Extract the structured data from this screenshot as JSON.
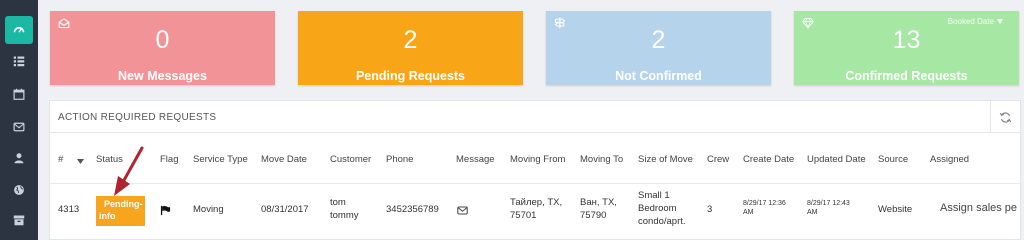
{
  "sidebar": {
    "items": [
      {
        "icon": "dashboard-icon",
        "active": true
      },
      {
        "icon": "list-icon"
      },
      {
        "icon": "calendar-icon"
      },
      {
        "icon": "envelope-icon"
      },
      {
        "icon": "user-icon"
      },
      {
        "icon": "globe-icon"
      },
      {
        "icon": "archive-icon"
      }
    ]
  },
  "cards": [
    {
      "count": "0",
      "label": "New Messages",
      "color": "#f29497",
      "icon": "envelope-open-icon"
    },
    {
      "count": "2",
      "label": "Pending Requests",
      "color": "#f9a518"
    },
    {
      "count": "2",
      "label": "Not Confirmed",
      "color": "#b5d3ea",
      "icon": "signpost-icon"
    },
    {
      "count": "13",
      "label": "Confirmed Requests",
      "color": "#a6e7a4",
      "icon": "diamond-icon",
      "filter_label": "Booked Date"
    }
  ],
  "panel": {
    "title": "ACTION REQUIRED REQUESTS",
    "columns": [
      "#",
      "Status",
      "Flag",
      "Service Type",
      "Move Date",
      "Customer",
      "Phone",
      "Message",
      "Moving From",
      "Moving To",
      "Size of Move",
      "Crew",
      "Create Date",
      "Updated Date",
      "Source",
      "Assigned"
    ],
    "row": {
      "id": "4313",
      "status_line1": "Pending-",
      "status_line2": "info",
      "service_type": "Moving",
      "move_date": "08/31/2017",
      "customer_line1": "tom",
      "customer_line2": "tommy",
      "phone": "3452356789",
      "moving_from_line1": "Тайлер, TX,",
      "moving_from_line2": "75701",
      "moving_to_line1": "Ван, TX,",
      "moving_to_line2": "75790",
      "size_line1": "Small 1",
      "size_line2": "Bedroom",
      "size_line3": "condo/aprt.",
      "crew": "3",
      "create_date_line1": "8/29/17 12:36",
      "create_date_line2": "AM",
      "updated_date_line1": "8/29/17 12:43",
      "updated_date_line2": "AM",
      "source": "Website",
      "assigned": "Assign sales pe"
    }
  },
  "colors": {
    "sidebar": "#2b3440",
    "accent": "#1bb9a4",
    "badge": "#f7a51c",
    "arrow": "#b02330"
  }
}
